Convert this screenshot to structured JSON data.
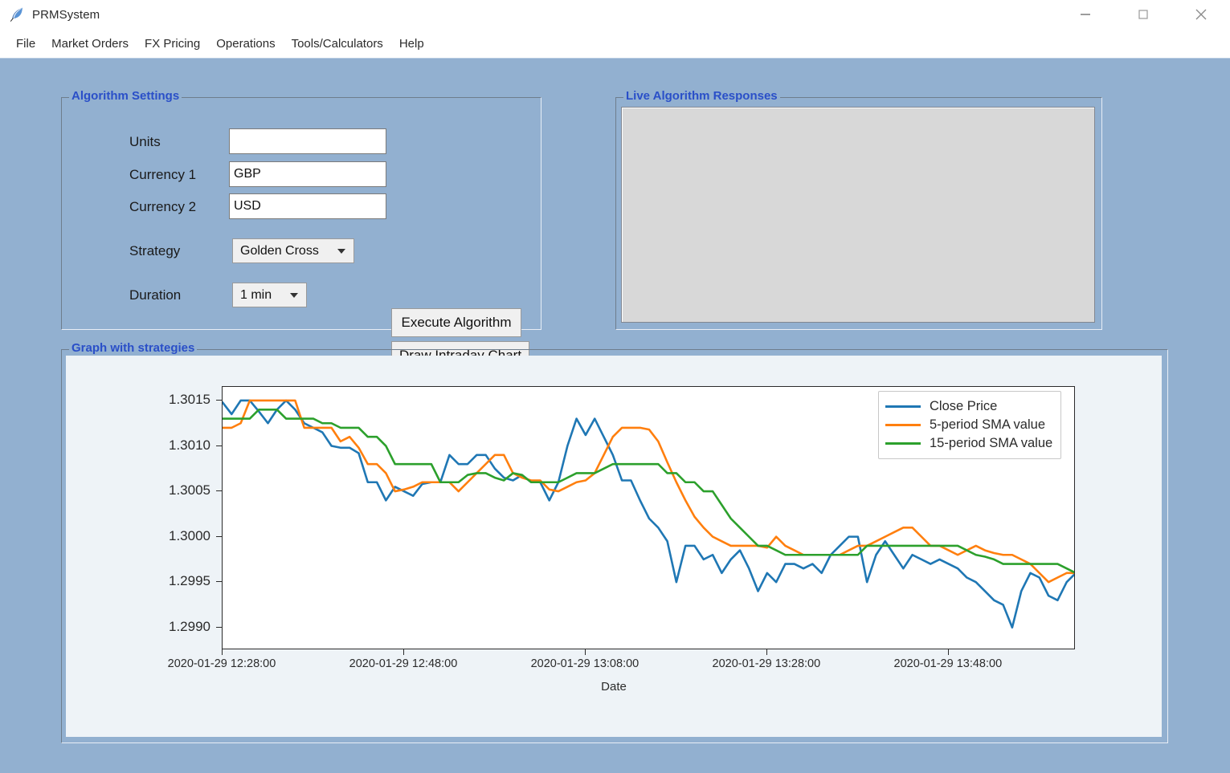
{
  "window": {
    "title": "PRMSystem",
    "icon": "feather-quill-icon",
    "controls": {
      "minimize": "minimize-icon",
      "maximize": "maximize-icon",
      "close": "close-icon"
    }
  },
  "menubar": {
    "items": [
      {
        "label": "File"
      },
      {
        "label": "Market Orders"
      },
      {
        "label": "FX Pricing"
      },
      {
        "label": "Operations"
      },
      {
        "label": "Tools/Calculators"
      },
      {
        "label": "Help"
      }
    ]
  },
  "algorithm_settings": {
    "title": "Algorithm Settings",
    "fields": [
      {
        "label": "Units",
        "value": "",
        "placeholder": ""
      },
      {
        "label": "Currency 1",
        "value": "GBP",
        "placeholder": ""
      },
      {
        "label": "Currency 2",
        "value": "USD",
        "placeholder": ""
      }
    ],
    "strategy": {
      "label": "Strategy",
      "selected": "Golden Cross",
      "options": [
        "Golden Cross"
      ]
    },
    "duration": {
      "label": "Duration",
      "selected": "1 min",
      "options": [
        "1 min"
      ]
    },
    "buttons": {
      "execute": "Execute Algorithm",
      "draw": "Draw Intraday Chart"
    }
  },
  "live_responses": {
    "title": "Live Algorithm Responses",
    "content": ""
  },
  "graph_panel": {
    "title": "Graph with strategies"
  },
  "colors": {
    "window_bg": "#92b0d0",
    "group_title": "#2a4fc8",
    "figure_bg": "#eef3f7",
    "plot_bg": "#ffffff",
    "close_price": "#1f77b4",
    "sma5": "#ff7f0e",
    "sma15": "#2ca02c",
    "listbox_bg": "#d8d8d8"
  },
  "chart_data": {
    "type": "line",
    "title": "",
    "xlabel": "Date",
    "ylabel": "",
    "grid": false,
    "legend_position": "upper right",
    "ylim": [
      1.29875,
      1.30165
    ],
    "yticks": [
      1.299,
      1.2995,
      1.3,
      1.3005,
      1.301,
      1.3015
    ],
    "ytick_labels": [
      "1.2990",
      "1.2995",
      "1.3000",
      "1.3005",
      "1.3010",
      "1.3015"
    ],
    "xtick_labels": [
      "2020-01-29 12:28:00",
      "2020-01-29 12:48:00",
      "2020-01-29 13:08:00",
      "2020-01-29 13:28:00",
      "2020-01-29 13:48:00"
    ],
    "xtick_positions": [
      0,
      20,
      40,
      60,
      80
    ],
    "xlim": [
      0,
      94
    ],
    "x": [
      0,
      1,
      2,
      3,
      4,
      5,
      6,
      7,
      8,
      9,
      10,
      11,
      12,
      13,
      14,
      15,
      16,
      17,
      18,
      19,
      20,
      21,
      22,
      23,
      24,
      25,
      26,
      27,
      28,
      29,
      30,
      31,
      32,
      33,
      34,
      35,
      36,
      37,
      38,
      39,
      40,
      41,
      42,
      43,
      44,
      45,
      46,
      47,
      48,
      49,
      50,
      51,
      52,
      53,
      54,
      55,
      56,
      57,
      58,
      59,
      60,
      61,
      62,
      63,
      64,
      65,
      66,
      67,
      68,
      69,
      70,
      71,
      72,
      73,
      74,
      75,
      76,
      77,
      78,
      79,
      80,
      81,
      82,
      83,
      84,
      85,
      86,
      87,
      88,
      89,
      90,
      91,
      92,
      93,
      94
    ],
    "series": [
      {
        "name": "Close Price",
        "color": "#1f77b4",
        "values": [
          1.30148,
          1.30135,
          1.3015,
          1.3015,
          1.30138,
          1.30125,
          1.3014,
          1.3015,
          1.3014,
          1.30125,
          1.3012,
          1.30115,
          1.301,
          1.30098,
          1.30098,
          1.30092,
          1.3006,
          1.3006,
          1.3004,
          1.30055,
          1.3005,
          1.30045,
          1.30058,
          1.3006,
          1.3006,
          1.3009,
          1.3008,
          1.3008,
          1.3009,
          1.3009,
          1.30075,
          1.30065,
          1.30062,
          1.30068,
          1.3006,
          1.3006,
          1.3004,
          1.3006,
          1.301,
          1.3013,
          1.30112,
          1.3013,
          1.3011,
          1.3009,
          1.30062,
          1.30062,
          1.3004,
          1.3002,
          1.3001,
          1.29995,
          1.2995,
          1.2999,
          1.2999,
          1.29975,
          1.2998,
          1.2996,
          1.29975,
          1.29985,
          1.29965,
          1.2994,
          1.2996,
          1.2995,
          1.2997,
          1.2997,
          1.29965,
          1.2997,
          1.2996,
          1.2998,
          1.2999,
          1.3,
          1.3,
          1.2995,
          1.2998,
          1.29995,
          1.2998,
          1.29965,
          1.2998,
          1.29975,
          1.2997,
          1.29975,
          1.2997,
          1.29965,
          1.29955,
          1.2995,
          1.2994,
          1.2993,
          1.29925,
          1.299,
          1.2994,
          1.2996,
          1.29955,
          1.29935,
          1.2993,
          1.2995,
          1.2996
        ]
      },
      {
        "name": "5-period SMA value",
        "color": "#ff7f0e",
        "values": [
          1.3012,
          1.3012,
          1.30125,
          1.3015,
          1.3015,
          1.3015,
          1.3015,
          1.3015,
          1.3015,
          1.3012,
          1.3012,
          1.3012,
          1.3012,
          1.30105,
          1.3011,
          1.30098,
          1.3008,
          1.3008,
          1.3007,
          1.3005,
          1.30052,
          1.30055,
          1.3006,
          1.3006,
          1.3006,
          1.3006,
          1.3005,
          1.3006,
          1.3007,
          1.3008,
          1.3009,
          1.3009,
          1.3007,
          1.30065,
          1.30062,
          1.30062,
          1.30052,
          1.3005,
          1.30055,
          1.3006,
          1.30062,
          1.3007,
          1.3009,
          1.3011,
          1.3012,
          1.3012,
          1.3012,
          1.30118,
          1.30105,
          1.30082,
          1.3006,
          1.3004,
          1.30022,
          1.3001,
          1.3,
          1.29995,
          1.2999,
          1.2999,
          1.2999,
          1.2999,
          1.29988,
          1.3,
          1.2999,
          1.29985,
          1.2998,
          1.2998,
          1.2998,
          1.2998,
          1.2998,
          1.29985,
          1.2999,
          1.2999,
          1.29995,
          1.3,
          1.30005,
          1.3001,
          1.3001,
          1.3,
          1.2999,
          1.2999,
          1.29985,
          1.2998,
          1.29985,
          1.2999,
          1.29985,
          1.29982,
          1.2998,
          1.2998,
          1.29975,
          1.2997,
          1.2996,
          1.2995,
          1.29955,
          1.2996,
          1.2996
        ]
      },
      {
        "name": "15-period SMA value",
        "color": "#2ca02c",
        "values": [
          1.3013,
          1.3013,
          1.3013,
          1.3013,
          1.3014,
          1.3014,
          1.3014,
          1.3013,
          1.3013,
          1.3013,
          1.3013,
          1.30125,
          1.30125,
          1.3012,
          1.3012,
          1.3012,
          1.3011,
          1.3011,
          1.301,
          1.3008,
          1.3008,
          1.3008,
          1.3008,
          1.3008,
          1.3006,
          1.3006,
          1.3006,
          1.30068,
          1.3007,
          1.3007,
          1.30065,
          1.30062,
          1.3007,
          1.30068,
          1.3006,
          1.3006,
          1.3006,
          1.3006,
          1.30065,
          1.3007,
          1.3007,
          1.3007,
          1.30075,
          1.3008,
          1.3008,
          1.3008,
          1.3008,
          1.3008,
          1.3008,
          1.3007,
          1.3007,
          1.3006,
          1.3006,
          1.3005,
          1.3005,
          1.30035,
          1.3002,
          1.3001,
          1.3,
          1.2999,
          1.2999,
          1.29985,
          1.2998,
          1.2998,
          1.2998,
          1.2998,
          1.2998,
          1.2998,
          1.2998,
          1.2998,
          1.2998,
          1.2999,
          1.2999,
          1.2999,
          1.2999,
          1.2999,
          1.2999,
          1.2999,
          1.2999,
          1.2999,
          1.2999,
          1.2999,
          1.29985,
          1.2998,
          1.29978,
          1.29975,
          1.2997,
          1.2997,
          1.2997,
          1.2997,
          1.2997,
          1.2997,
          1.2997,
          1.29965,
          1.2996
        ]
      }
    ]
  }
}
